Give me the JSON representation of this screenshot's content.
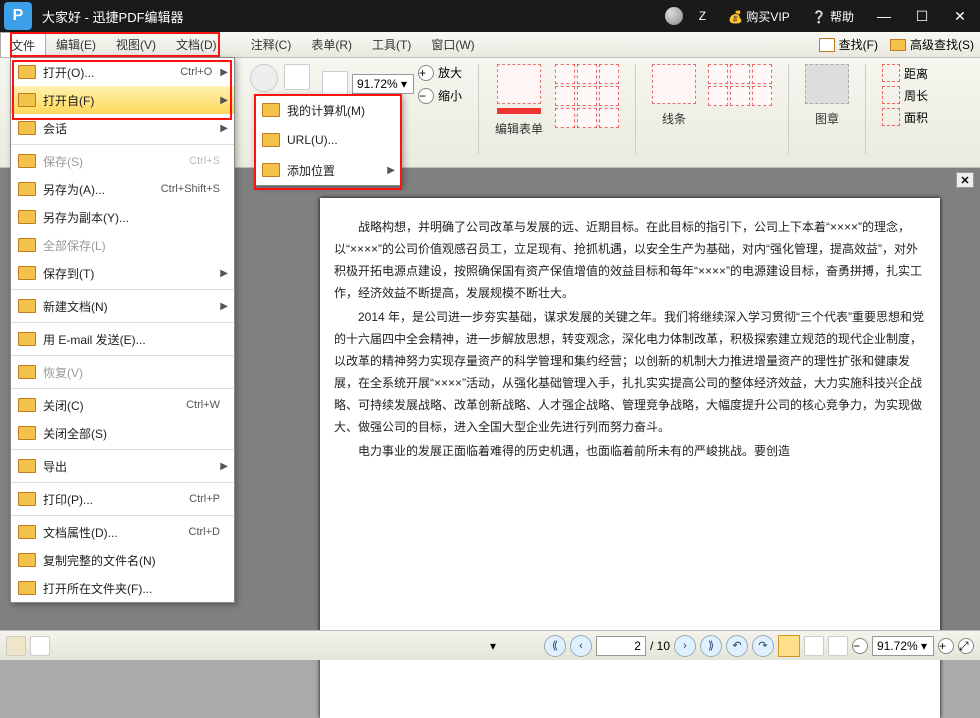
{
  "title": "大家好 - 迅捷PDF编辑器",
  "titlebar": {
    "user": "Z",
    "vip": "购买VIP",
    "help": "帮助"
  },
  "menubar": {
    "items": [
      "文件",
      "编辑(E)",
      "视图(V)",
      "文档(D)",
      "注释(C)",
      "表单(R)",
      "工具(T)",
      "窗口(W)"
    ],
    "find": "查找(F)",
    "advfind": "高级查找(S)"
  },
  "file_menu": [
    {
      "label": "打开(O)...",
      "sc": "Ctrl+O",
      "sub": true,
      "icon": "folder"
    },
    {
      "label": "打开自(F)",
      "sub": true,
      "hover": true,
      "icon": "folder-globe"
    },
    {
      "label": "会话",
      "sub": true,
      "icon": "sessions"
    },
    {
      "sep": true
    },
    {
      "label": "保存(S)",
      "sc": "Ctrl+S",
      "icon": "save",
      "disabled": true
    },
    {
      "label": "另存为(A)...",
      "sc": "Ctrl+Shift+S",
      "icon": "save-as"
    },
    {
      "label": "另存为副本(Y)...",
      "icon": "save-copy"
    },
    {
      "label": "全部保存(L)",
      "icon": "save-all",
      "disabled": true
    },
    {
      "label": "保存到(T)",
      "sub": true,
      "icon": "save-to"
    },
    {
      "sep": true
    },
    {
      "label": "新建文档(N)",
      "sub": true,
      "icon": "new-doc"
    },
    {
      "sep": true
    },
    {
      "label": "用 E-mail 发送(E)...",
      "icon": "email"
    },
    {
      "sep": true
    },
    {
      "label": "恢复(V)",
      "icon": "revert",
      "disabled": true
    },
    {
      "sep": true
    },
    {
      "label": "关闭(C)",
      "sc": "Ctrl+W",
      "icon": "close-doc"
    },
    {
      "label": "关闭全部(S)",
      "icon": "close-all"
    },
    {
      "sep": true
    },
    {
      "label": "导出",
      "sub": true,
      "icon": "export"
    },
    {
      "sep": true
    },
    {
      "label": "打印(P)...",
      "sc": "Ctrl+P",
      "icon": "print"
    },
    {
      "sep": true
    },
    {
      "label": "文档属性(D)...",
      "sc": "Ctrl+D",
      "icon": "props"
    },
    {
      "label": "复制完整的文件名(N)",
      "icon": "copy-path"
    },
    {
      "label": "打开所在文件夹(F)...",
      "icon": "open-folder"
    }
  ],
  "open_from_submenu": [
    {
      "label": "我的计算机(M)",
      "icon": "pc"
    },
    {
      "label": "URL(U)...",
      "icon": "url"
    },
    {
      "label": "添加位置",
      "sub": true,
      "icon": "add-loc"
    }
  ],
  "ribbon": {
    "zoom": "91.72%",
    "zoom_in": "放大",
    "zoom_out": "缩小",
    "edit_form": "编辑表单",
    "lines": "线条",
    "stamp": "图章",
    "distance": "距离",
    "perimeter": "周长",
    "area": "面积"
  },
  "statusbar": {
    "page_cur": "2",
    "page_total": "10",
    "zoom": "91.72%"
  },
  "doc_body": [
    "战略构想，并明确了公司改革与发展的远、近期目标。在此目标的指引下，公司上下本着“××××”的理念，以“××××”的公司价值观感召员工，立足现有、抢抓机遇，以安全生产为基础，对内“强化管理，提高效益”，对外积极开拓电源点建设，按照确保国有资产保值增值的效益目标和每年“××××”的电源建设目标，奋勇拼搏，扎实工作，经济效益不断提高，发展规模不断壮大。",
    "2014 年，是公司进一步夯实基础，谋求发展的关键之年。我们将继续深入学习贯彻“三个代表”重要思想和党的十六届四中全会精神，进一步解放思想，转变观念，深化电力体制改革，积极探索建立规范的现代企业制度，以改革的精神努力实现存量资产的科学管理和集约经营；以创新的机制大力推进增量资产的理性扩张和健康发展，在全系统开展“××××”活动，从强化基础管理入手，扎扎实实提高公司的整体经济效益，大力实施科技兴企战略、可持续发展战略、改革创新战略、人才强企战略、管理竞争战略，大幅度提升公司的核心竞争力，为实现做大、做强公司的目标，进入全国大型企业先进行列而努力奋斗。",
    "电力事业的发展正面临着难得的历史机遇，也面临着前所未有的严峻挑战。要创造"
  ]
}
